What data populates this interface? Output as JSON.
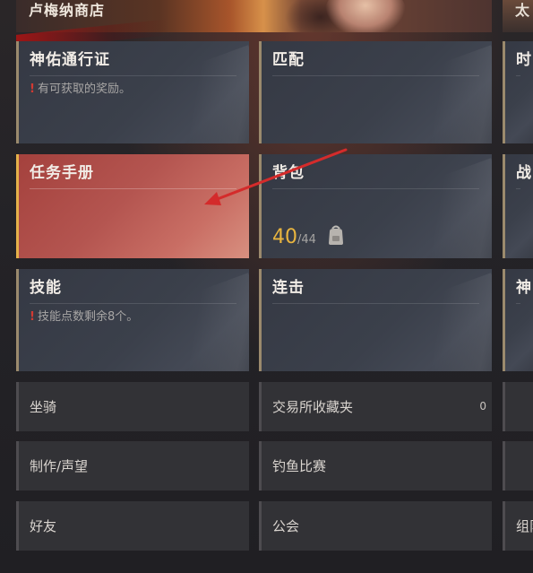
{
  "banner": {
    "title": "卢梅纳商店",
    "right_title": "太"
  },
  "tiles": {
    "battle_pass": {
      "title": "神佑通行证",
      "notice": "有可获取的奖励。"
    },
    "match": {
      "title": "匹配"
    },
    "right_row1": {
      "title": "时"
    },
    "quest_journal": {
      "title": "任务手册"
    },
    "inventory": {
      "title": "背包",
      "current": "40",
      "separator": "/",
      "max": "44"
    },
    "right_row2": {
      "title": "战"
    },
    "skills": {
      "title": "技能",
      "notice": "技能点数剩余8个。"
    },
    "combo": {
      "title": "连击"
    },
    "right_row3": {
      "title": "神"
    }
  },
  "menu": {
    "mount": {
      "label": "坐骑"
    },
    "trade_favorites": {
      "label": "交易所收藏夹",
      "count": "0"
    },
    "crafting": {
      "label": "制作/声望"
    },
    "fishing": {
      "label": "钓鱼比赛"
    },
    "friends": {
      "label": "好友"
    },
    "guild": {
      "label": "公会"
    },
    "right_last": {
      "label": "组队"
    }
  },
  "colors": {
    "accent_gold": "#e9b53f",
    "selected_red": "#b45550",
    "alert_red": "#d23a32",
    "arrow_red": "#d42b2b"
  },
  "icons": {
    "bag": "backpack-icon",
    "alert": "exclamation-icon"
  }
}
